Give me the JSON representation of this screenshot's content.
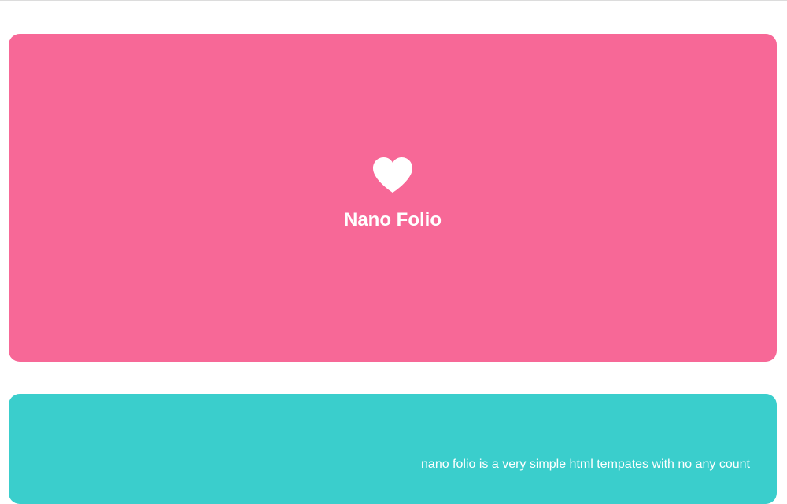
{
  "hero": {
    "icon": "heart-icon",
    "title": "Nano Folio",
    "background_color": "#f76897"
  },
  "about": {
    "text": "nano folio is a very simple html tempates with no any count",
    "background_color": "#3acecc"
  },
  "colors": {
    "text": "#ffffff",
    "page_background": "#ffffff"
  }
}
